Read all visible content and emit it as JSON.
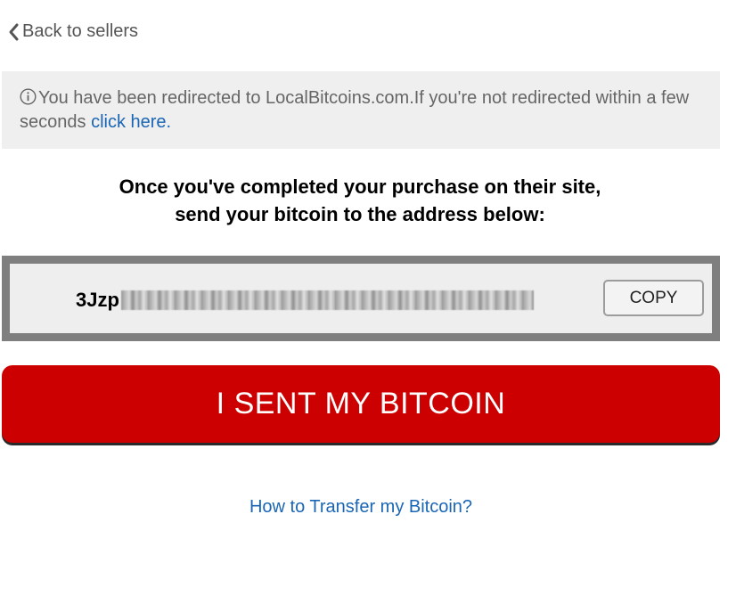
{
  "nav": {
    "back_label": "Back to sellers",
    "back_icon": "chevron-left-icon"
  },
  "notice": {
    "icon": "info-circle-icon",
    "text": "You have been redirected to LocalBitcoins.com.If you're not redirected within a few seconds ",
    "link_label": "click here."
  },
  "instruction": {
    "line1": "Once you've completed your purchase on their site,",
    "line2": "send your bitcoin to the address below:"
  },
  "address": {
    "visible_prefix": "3Jzp",
    "copy_label": "COPY"
  },
  "sent_button_label": "I SENT MY BITCOIN",
  "help_link_label": "How to Transfer my Bitcoin?",
  "colors": {
    "primary_red": "#cc0000",
    "link_blue": "#1a66b5",
    "notice_bg": "#efefef",
    "address_border": "#7f7f7f"
  }
}
